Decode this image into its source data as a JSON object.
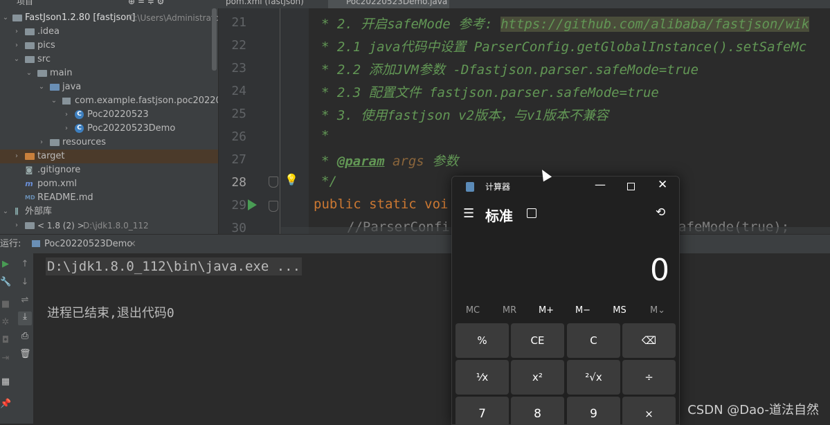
{
  "top_strip": {
    "project_label": "项目",
    "tabs": [
      "pom.xml (fastjson)",
      "Poc20220523Demo.java"
    ]
  },
  "project_tree": {
    "root_name": "FastJson1.2.80 [fastjson]",
    "root_path": "C:\\Users\\Administrato",
    "items": [
      {
        "label": ".idea"
      },
      {
        "label": "pics"
      },
      {
        "label": "src"
      },
      {
        "label": "main"
      },
      {
        "label": "java"
      },
      {
        "label": "com.example.fastjson.poc20220523"
      },
      {
        "label": "Poc20220523"
      },
      {
        "label": "Poc20220523Demo"
      },
      {
        "label": "resources"
      },
      {
        "label": "target"
      },
      {
        "label": ".gitignore"
      },
      {
        "label": "pom.xml"
      },
      {
        "label": "README.md"
      },
      {
        "label": "外部库"
      },
      {
        "label": "< 1.8 (2) >",
        "extra": "D:\\jdk1.8.0_112"
      }
    ]
  },
  "editor": {
    "line_numbers": [
      "21",
      "22",
      "23",
      "24",
      "25",
      "26",
      "27",
      "28",
      "29",
      "30"
    ],
    "lines": [
      {
        "star": "* ",
        "text": "2. 开启safeMode 参考:",
        "link": "https://github.com/alibaba/fastjson/wik"
      },
      {
        "star": "* ",
        "text": "2.1 java代码中设置 ParserConfig.getGlobalInstance().setSafeMc"
      },
      {
        "star": "* ",
        "text": "2.2 添加JVM参数 -Dfastjson.parser.safeMode=true"
      },
      {
        "star": "* ",
        "text": "2.3 配置文件 fastjson.parser.safeMode=true"
      },
      {
        "star": "* ",
        "text": "3. 使用fastjson v2版本，与v1版本不兼容"
      },
      {
        "star": "*",
        "text": ""
      },
      {
        "star": "* ",
        "tag": "@param",
        "param": "args",
        "text": "参数"
      },
      {
        "star": "*/",
        "text": ""
      },
      {
        "kw": "public static voi",
        "text": ""
      },
      {
        "text": "//ParserConfi",
        "tail": "afeMode(true);"
      }
    ]
  },
  "run_panel": {
    "label": "运行:",
    "tab": "Poc20220523Demo",
    "command": "D:\\jdk1.8.0_112\\bin\\java.exe ...",
    "exit_message": "进程已结束,退出代码0"
  },
  "calculator": {
    "title": "计算器",
    "mode": "标准",
    "display": "0",
    "memory_buttons": [
      "MC",
      "MR",
      "M+",
      "M−",
      "MS",
      "M⌄"
    ],
    "rows": [
      [
        "%",
        "CE",
        "C",
        "⌫"
      ],
      [
        "¹⁄x",
        "x²",
        "²√x",
        "÷"
      ],
      [
        "7",
        "8",
        "9",
        "×"
      ]
    ]
  },
  "watermark": "CSDN @Dao-道法自然",
  "colors": {
    "ide_bg": "#2b2b2b",
    "panel_bg": "#3c3f41",
    "comment": "#629755",
    "keyword": "#cc7832",
    "calc_bg": "#202020",
    "calc_btn": "#3b3b3b"
  }
}
